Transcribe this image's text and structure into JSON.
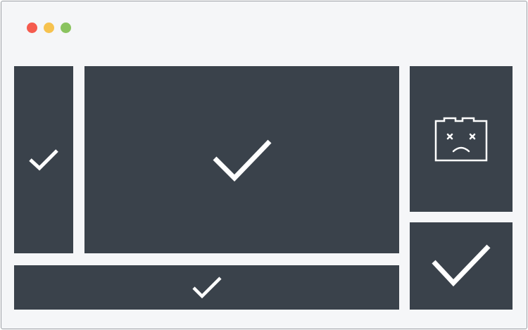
{
  "colors": {
    "background": "#f5f6f8",
    "frame_border": "#9a9ea4",
    "tile": "#3a424b",
    "icon": "#ffffff",
    "close_dot": "#f55b4e",
    "minimize_dot": "#f6c24f",
    "maximize_dot": "#8ac35f"
  },
  "window_controls": [
    "close",
    "minimize",
    "maximize"
  ],
  "tiles": [
    {
      "id": "left-sidebar",
      "icon": "checkmark-icon",
      "status": "loaded"
    },
    {
      "id": "main",
      "icon": "checkmark-icon",
      "status": "loaded"
    },
    {
      "id": "right-top",
      "icon": "broken-plugin-sad-face-icon",
      "status": "error"
    },
    {
      "id": "right-bottom",
      "icon": "checkmark-icon",
      "status": "loaded"
    },
    {
      "id": "bottom-bar",
      "icon": "checkmark-icon",
      "status": "loaded"
    }
  ]
}
